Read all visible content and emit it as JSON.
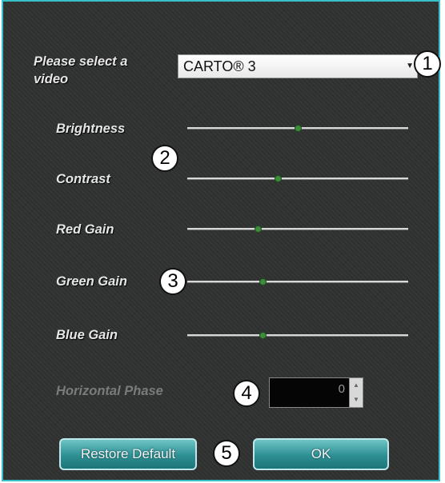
{
  "video": {
    "label": "Please select a video",
    "selected": "CARTO® 3"
  },
  "sliders": [
    {
      "label": "Brightness",
      "value": 0.5
    },
    {
      "label": "Contrast",
      "value": 0.41
    },
    {
      "label": "Red Gain",
      "value": 0.32
    },
    {
      "label": "Green Gain",
      "value": 0.34
    },
    {
      "label": "Blue Gain",
      "value": 0.34
    }
  ],
  "horizontal_phase": {
    "label": "Horizontal Phase",
    "value": "0"
  },
  "buttons": {
    "restore": "Restore Default",
    "ok": "OK"
  },
  "callouts": [
    "1",
    "2",
    "3",
    "4",
    "5"
  ],
  "colors": {
    "border": "#38c0c8",
    "panel": "#2e3030",
    "thumb": "#3c8c3c",
    "button": "#2e8f93"
  }
}
